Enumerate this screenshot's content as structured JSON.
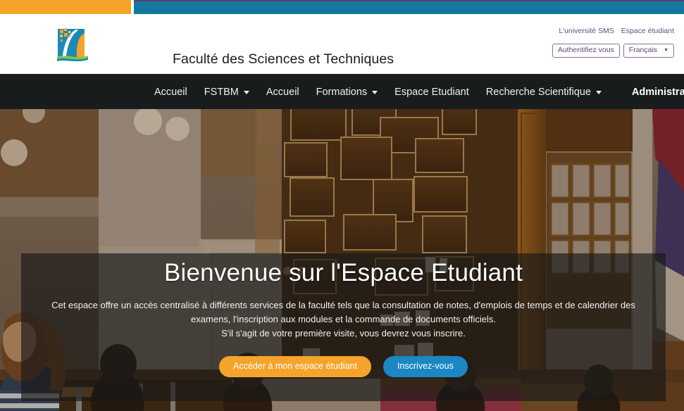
{
  "topbars": {
    "orange_color": "#f5a42b",
    "teal_color": "#14789e",
    "accent_line_color": "#5c3f70"
  },
  "header": {
    "site_title": "Faculté des Sciences et Techniques",
    "logo_name": "fstbm-logo",
    "top_links": [
      {
        "label": "L'université SMS"
      },
      {
        "label": "Espace étudiant"
      }
    ],
    "auth_button": "Authentifiez vous",
    "language_button": "Français",
    "language_caret": "▼"
  },
  "nav": {
    "items": [
      {
        "label": "Accueil",
        "has_dropdown": false
      },
      {
        "label": "FSTBM",
        "has_dropdown": true
      },
      {
        "label": "Accueil",
        "has_dropdown": false
      },
      {
        "label": "Formations",
        "has_dropdown": true
      },
      {
        "label": "Espace Etudiant",
        "has_dropdown": false
      },
      {
        "label": "Recherche Scientifique",
        "has_dropdown": true
      }
    ],
    "user": {
      "name": "Administrator",
      "avatar_icon": "user-avatar-icon",
      "caret": "▼"
    }
  },
  "hero": {
    "title": "Bienvenue sur l'Espace Etudiant",
    "paragraph": "Cet espace offre un accès centralisé à différents services de la faculté tels que la consultation de notes, d'emplois de temps et de calendrier des examens, l'inscription aux modules et la commande de documents officiels.",
    "note": "S'il s'agit de votre première visite, vous devrez vous inscrire.",
    "primary_button": "Accéder à mon espace étudiant",
    "secondary_button": "Inscrivez-vous",
    "primary_button_color": "#f5a42b",
    "secondary_button_color": "#1b87c4",
    "overlay_color": "rgba(24,24,24,0.66)"
  }
}
